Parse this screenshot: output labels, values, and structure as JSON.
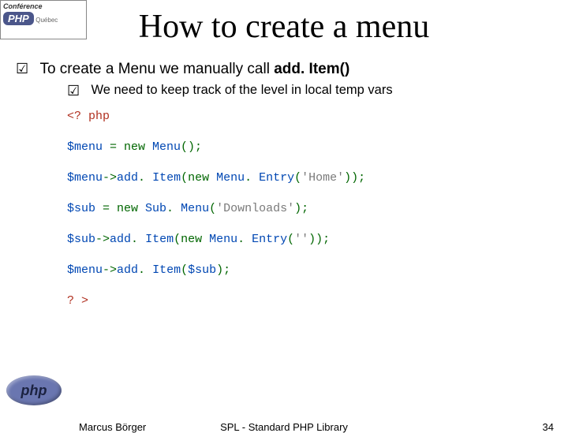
{
  "conference": {
    "label": "Conférence",
    "php": "PHP",
    "region": "Québec"
  },
  "php_logo": "php",
  "title": "How to create a menu",
  "bullets": {
    "main_pre": "To create a Menu we manually call ",
    "main_bold": "add. Item()",
    "sub": "We need to keep track of the level in local temp vars"
  },
  "code": {
    "l1": "<? php",
    "l2a": "$menu ",
    "l2b": "= new ",
    "l2c": "Menu",
    "l2d": "();",
    "l3a": "$menu",
    "l3b": "->",
    "l3c": "add",
    "l3d": ". ",
    "l3e": "Item",
    "l3f": "(new ",
    "l3g": "Menu",
    "l3h": ". ",
    "l3i": "Entry",
    "l3j": "(",
    "l3k": "'Home'",
    "l3l": "));",
    "l4a": "$sub ",
    "l4b": "= new ",
    "l4c": "Sub",
    "l4d": ". ",
    "l4e": "Menu",
    "l4f": "(",
    "l4g": "'Downloads'",
    "l4h": ");",
    "l5a": "$sub",
    "l5b": "->",
    "l5c": "add",
    "l5d": ". ",
    "l5e": "Item",
    "l5f": "(new ",
    "l5g": "Menu",
    "l5h": ". ",
    "l5i": "Entry",
    "l5j": "(",
    "l5k": "''",
    "l5l": "));",
    "l6a": "$menu",
    "l6b": "->",
    "l6c": "add",
    "l6d": ". ",
    "l6e": "Item",
    "l6f": "(",
    "l6g": "$sub",
    "l6h": ");",
    "l7": "? >"
  },
  "footer": {
    "author": "Marcus Börger",
    "center": "SPL - Standard PHP Library",
    "page": "34"
  },
  "check_glyph": "☑"
}
